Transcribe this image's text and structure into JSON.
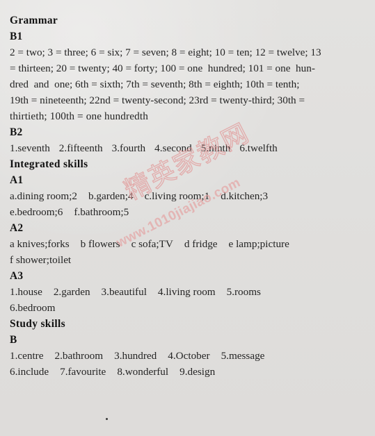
{
  "page": {
    "background_color": "#e1e0de",
    "text_color": "#242424",
    "watermark_color": "#e29696"
  },
  "watermark": {
    "brand_cn": "精英家教网",
    "url": "www.1010jiajiao.com"
  },
  "sections": [
    {
      "heading": "Grammar",
      "blocks": [
        {
          "label_letter": "B",
          "label_number": "1",
          "lines": [
            "2 = two; 3 = three; 6 = six; 7 = seven; 8 = eight; 10 = ten; 12 = twelve; 13",
            "= thirteen; 20 = twenty; 40 = forty; 100 = one  hundred; 101 = one  hun-",
            "dred  and  one; 6th = sixth; 7th = seventh; 8th = eighth; 10th = tenth;",
            "19th = nineteenth; 22nd = twenty-second; 23rd = twenty-third; 30th =",
            "thirtieth; 100th = one  hundredth"
          ]
        },
        {
          "label_letter": "B",
          "label_number": "2",
          "answers": [
            "1.seventh",
            "2.fifteenth",
            "3.fourth",
            "4.second",
            "5.ninth",
            "6.twelfth"
          ]
        }
      ]
    },
    {
      "heading": "Integrated skills",
      "blocks": [
        {
          "label_letter": "A",
          "label_number": "1",
          "answers_rows": [
            [
              "a.dining  room;2",
              "b.garden;4",
              "c.living  room;1",
              "d.kitchen;3"
            ],
            [
              "e.bedroom;6",
              "f.bathroom;5"
            ]
          ]
        },
        {
          "label_letter": "A",
          "label_number": "2",
          "answers_rows": [
            [
              "a knives;forks",
              "b flowers",
              "c sofa;TV",
              "d fridge",
              "e lamp;picture"
            ],
            [
              "f shower;toilet"
            ]
          ]
        },
        {
          "label_letter": "A",
          "label_number": "3",
          "answers_rows": [
            [
              "1.house",
              "2.garden",
              "3.beautiful",
              "4.living  room",
              "5.rooms"
            ],
            [
              "6.bedroom"
            ]
          ]
        }
      ]
    },
    {
      "heading": "Study skills",
      "blocks": [
        {
          "label_letter": "B",
          "label_number": "",
          "answers_rows": [
            [
              "1.centre",
              "2.bathroom",
              "3.hundred",
              "4.October",
              "5.message"
            ],
            [
              "6.include",
              "7.favourite",
              "8.wonderful",
              "9.design"
            ]
          ]
        }
      ]
    }
  ]
}
